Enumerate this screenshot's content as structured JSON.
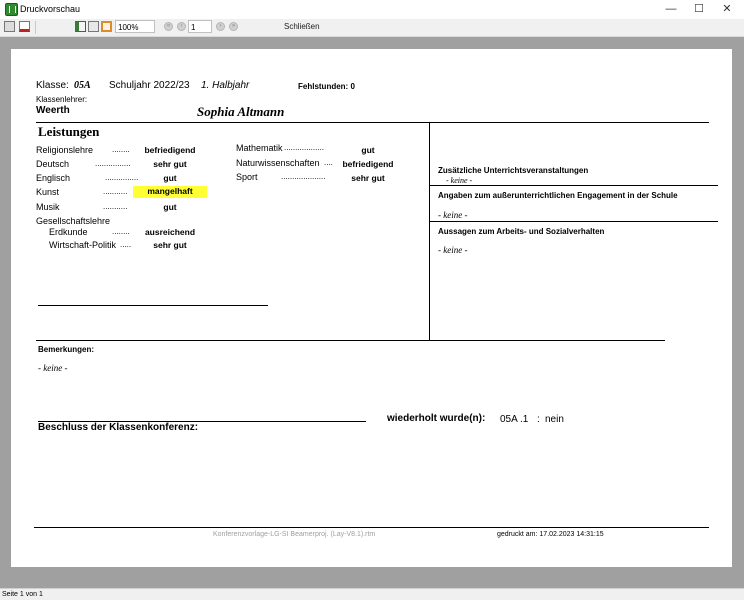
{
  "window": {
    "title": "Druckvorschau",
    "minimize": "—",
    "maximize": "☐",
    "close": "✕"
  },
  "toolbar": {
    "zoom": "100%",
    "page": "1",
    "close_label": "Schließen"
  },
  "status": {
    "page_info": "Seite 1 von 1"
  },
  "report": {
    "class_label": "Klasse:",
    "class_value": "05A",
    "school_year": "Schuljahr 2022/23",
    "half_year": "1. Halbjahr",
    "absences": "Fehlstunden: 0",
    "teacher_label": "Klassenlehrer:",
    "teacher_name": "Weerth",
    "student_name": "Sophia Altmann",
    "performance_title": "Leistungen",
    "subjects_left": [
      {
        "subject": "Religionslehre",
        "dots": "........",
        "grade": "befriedigend"
      },
      {
        "subject": "Deutsch",
        "dots": "................",
        "grade": "sehr gut"
      },
      {
        "subject": "Englisch",
        "dots": "...............",
        "grade": "gut"
      },
      {
        "subject": "Kunst",
        "dots": "...........",
        "grade": "mangelhaft"
      },
      {
        "subject": "Musik",
        "dots": "...........",
        "grade": "gut"
      }
    ],
    "subjects_right": [
      {
        "subject": "Mathematik",
        "dots": "..................",
        "grade": "gut"
      },
      {
        "subject": "Naturwissenschaften",
        "dots": "....",
        "grade": "befriedigend"
      },
      {
        "subject": "Sport",
        "dots": "....................",
        "grade": "sehr gut"
      }
    ],
    "social_studies_label": "Gesellschaftslehre",
    "social_studies": [
      {
        "subject": "Erdkunde",
        "dots": "........",
        "grade": "ausreichend"
      },
      {
        "subject": "Wirtschaft-Politik",
        "dots": ".....",
        "grade": "sehr gut"
      }
    ],
    "extra_lessons_label": "Zusätzliche Unterrichtsveranstaltungen",
    "extra_lessons_value": "- keine -",
    "engagement_label": "Angaben zum außerunterrichtlichen Engagement in der Schule",
    "engagement_value": "- keine -",
    "behavior_label": "Aussagen zum Arbeits- und Sozialverhalten",
    "behavior_value": "- keine -",
    "remarks_label": "Bemerkungen:",
    "remarks_value": "- keine -",
    "decision_label": "Beschluss der Klassenkonferenz:",
    "repeated_label": "wiederholt wurde(n):",
    "repeated_class": "05A .1",
    "repeated_sep": ":",
    "repeated_value": "nein",
    "footer_template": "Konferenzvorlage-LG-SI Beamerproj. (Lay-V8.1).rtm",
    "printed_on": "gedruckt am: 17.02.2023 14:31:15"
  },
  "colors": {
    "highlight": "#ffff33",
    "canvas": "#a0a0a0"
  }
}
